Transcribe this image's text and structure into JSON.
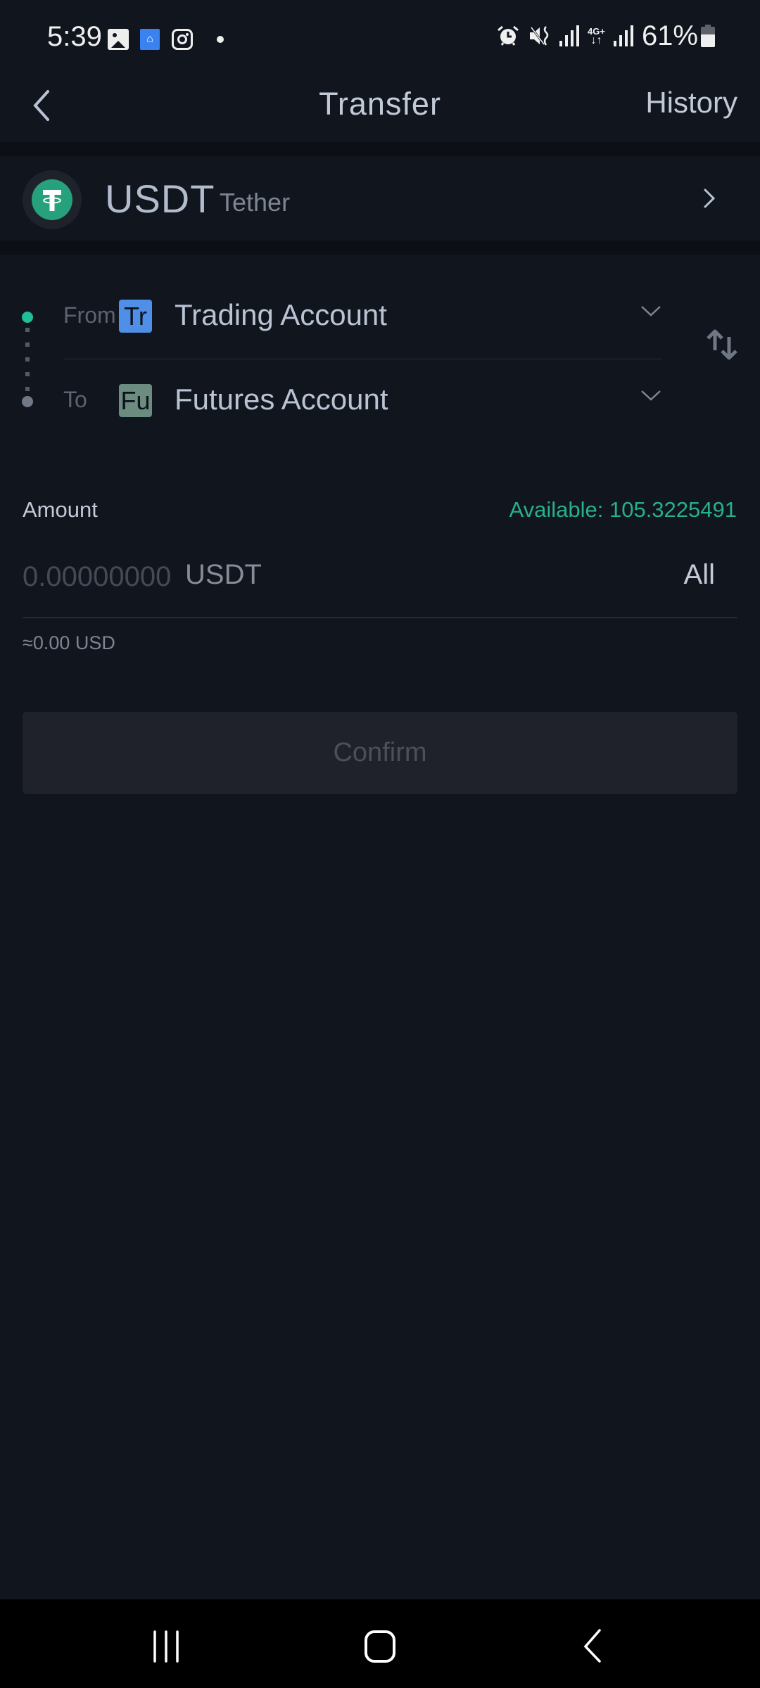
{
  "status_bar": {
    "time": "5:39",
    "notification_icons": [
      "gallery-icon",
      "genie-lamp-app-icon",
      "instagram-icon",
      "more-dot-icon"
    ],
    "system_icons": [
      "alarm-icon",
      "vibrate-mute-icon",
      "signal-icon",
      "4g-plus-data-icon",
      "signal-icon"
    ],
    "network_label": "4G+",
    "battery_percent": "61%",
    "battery_level": 0.61
  },
  "header": {
    "title": "Transfer",
    "history_label": "History"
  },
  "coin": {
    "symbol": "USDT",
    "name": "Tether",
    "logo_color": "#27a17c"
  },
  "accounts": {
    "from": {
      "label": "From",
      "badge": "Tr",
      "badge_color": "#4f8fe8",
      "name": "Trading Account",
      "dot_color": "#1ec09a"
    },
    "to": {
      "label": "To",
      "badge": "Fu",
      "badge_color": "#6b8c7e",
      "name": "Futures Account",
      "dot_color": "#727986"
    }
  },
  "amount": {
    "label": "Amount",
    "available_label": "Available:",
    "available_value": "105.3225491",
    "available_text": "Available:  105.3225491",
    "input_value": "",
    "input_placeholder": "0.00000000",
    "unit": "USDT",
    "all_label": "All",
    "usd_approx": "≈0.00 USD"
  },
  "confirm_label": "Confirm",
  "colors": {
    "background": "#11151e",
    "accent_green": "#27b08d",
    "text_primary": "#c3cad7",
    "button_disabled_bg": "#1f222b",
    "button_disabled_text": "#4a4f5a"
  },
  "nav_bar": {
    "buttons": [
      "recents-button",
      "home-button",
      "back-button"
    ]
  }
}
